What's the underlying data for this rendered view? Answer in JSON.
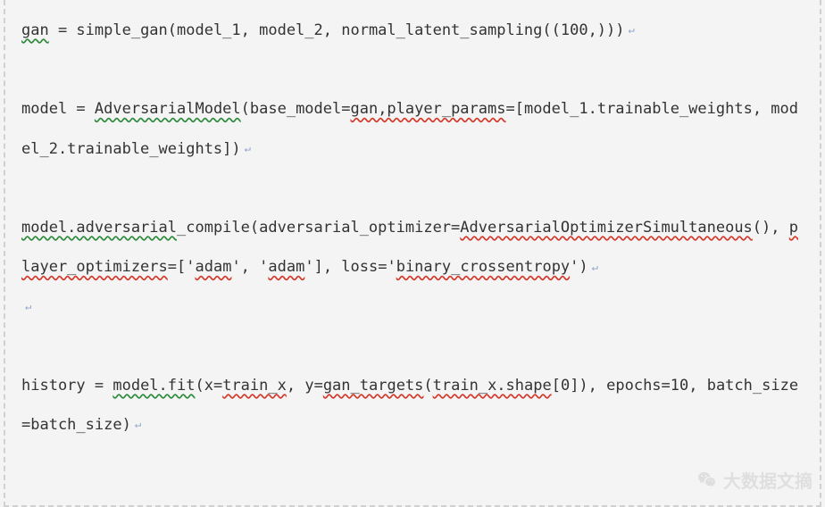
{
  "code": {
    "line1_a": "gan",
    "line1_b": " = simple_gan(model_1, model_2, normal_latent_sampling((100,)))",
    "blank": "",
    "line2_a": "model = ",
    "line2_b": "AdversarialModel",
    "line2_c": "(base_model=",
    "line2_d": "gan,player_params",
    "line2_e": "=[model_1.trainable_weights, model_2.trainable_weights])",
    "line3_a": "model.adversarial",
    "line3_b": "_compile(adversarial_optimizer=",
    "line3_c": "AdversarialOptimizerSimultaneous",
    "line3_d": "(), ",
    "line3_e": "player_optimizers",
    "line3_f": "=['",
    "line3_g": "adam",
    "line3_h": "', '",
    "line3_i": "adam",
    "line3_j": "'], loss='",
    "line3_k": "binary_crossentropy",
    "line3_l": "')",
    "line4_a": "history = ",
    "line4_b": "model.fit",
    "line4_c": "(x=",
    "line4_d": "train_x",
    "line4_e": ", y=",
    "line4_f": "gan_targets",
    "line4_g": "(",
    "line4_h": "train_x.shape",
    "line4_i": "[0]), epochs=10, batch_size=batch_size)"
  },
  "glyph": "↵",
  "watermark": {
    "text": "大数据文摘"
  }
}
